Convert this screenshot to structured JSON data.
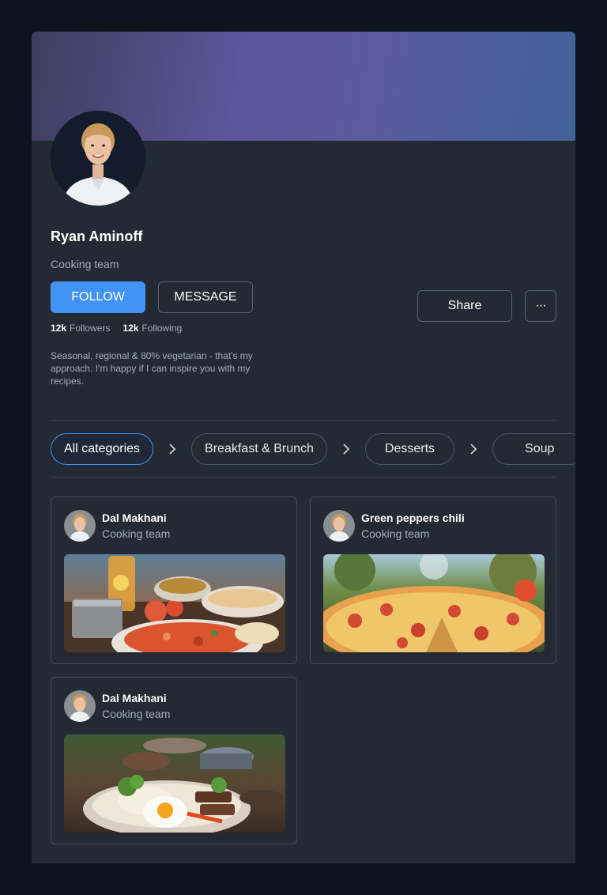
{
  "profile": {
    "name": "Ryan Aminoff",
    "role": "Cooking team",
    "followers_count": "12k",
    "followers_label": "Followers",
    "following_count": "12k",
    "following_label": "Following",
    "bio": "Seasonal, regional & 80% vegetarian - that's my approach. I'm happy if I can inspire you with my recipes."
  },
  "actions": {
    "follow": "FOLLOW",
    "message": "MESSAGE",
    "share": "Share",
    "more": "···"
  },
  "categories": [
    {
      "label": "All categories",
      "active": true
    },
    {
      "label": "Breakfast & Brunch",
      "active": false
    },
    {
      "label": "Desserts",
      "active": false
    },
    {
      "label": "Soup",
      "active": false
    }
  ],
  "recipes": [
    {
      "title": "Dal Makhani",
      "author": "Cooking team",
      "image": "indian-meal-photo"
    },
    {
      "title": "Green peppers chili",
      "author": "Cooking team",
      "image": "pizza-photo"
    },
    {
      "title": "Dal Makhani",
      "author": "Cooking team",
      "image": "rice-bowl-egg-photo"
    }
  ],
  "colors": {
    "accent": "#4293f5",
    "card": "#242a33",
    "background": "#0e141d"
  }
}
